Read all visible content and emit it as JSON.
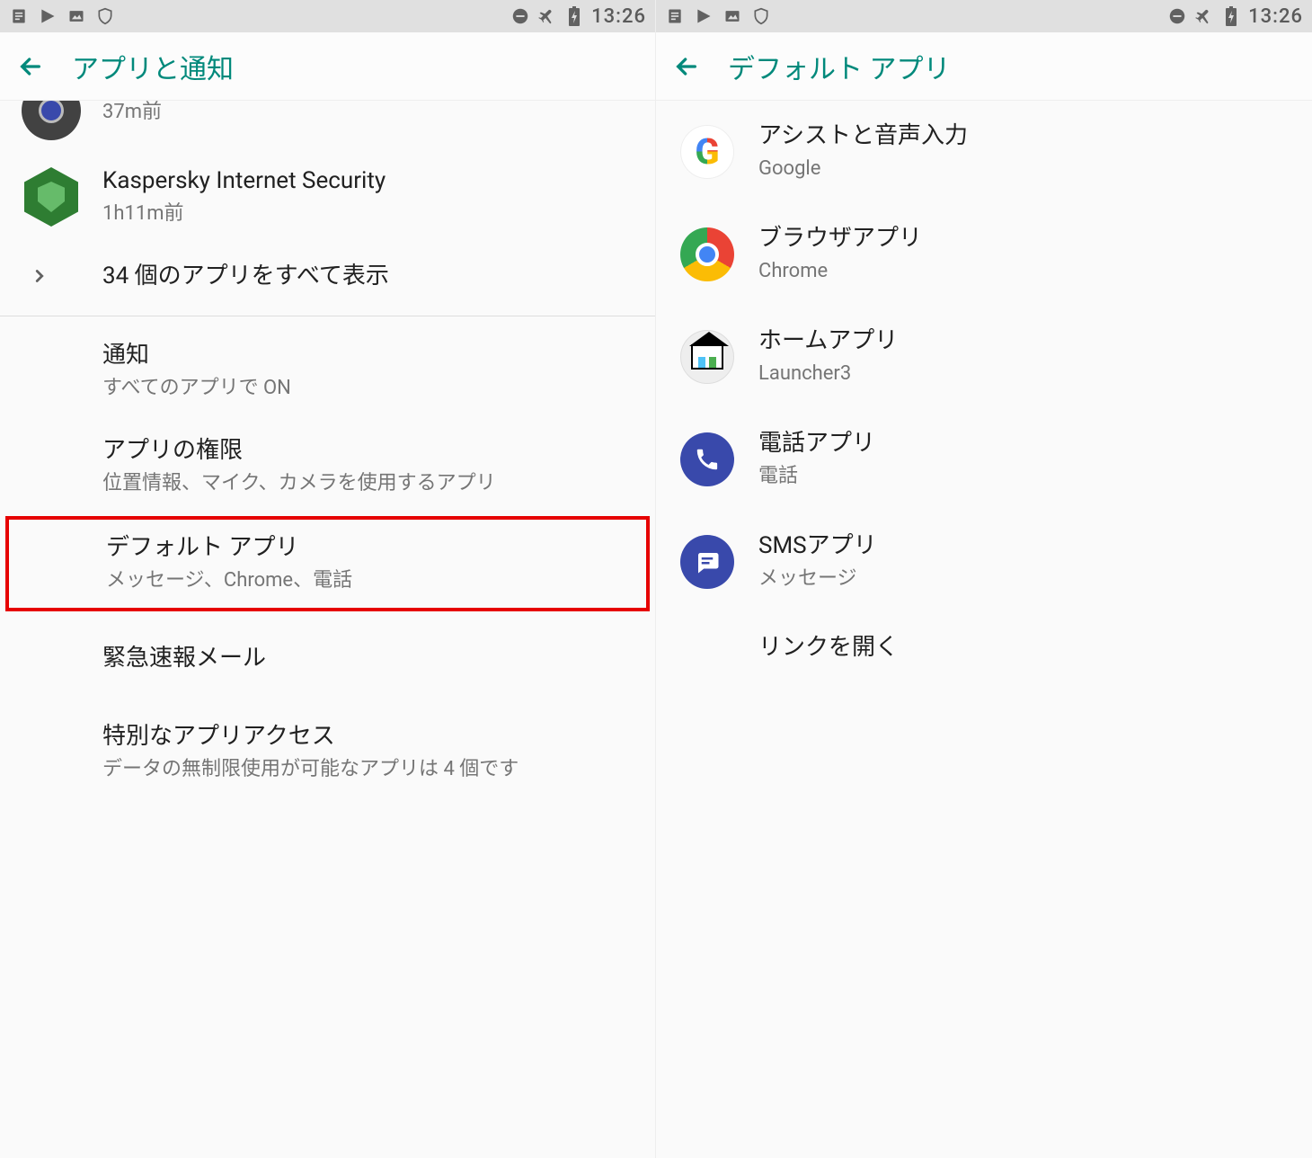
{
  "status": {
    "time": "13:26"
  },
  "screens": [
    {
      "title": "アプリと通知",
      "camera": {
        "subtitle": "37m前"
      },
      "kaspersky": {
        "title": "Kaspersky Internet Security",
        "subtitle": "1h11m前"
      },
      "see_all": {
        "title": "34 個のアプリをすべて表示"
      },
      "items": [
        {
          "title": "通知",
          "subtitle": "すべてのアプリで ON"
        },
        {
          "title": "アプリの権限",
          "subtitle": "位置情報、マイク、カメラを使用するアプリ"
        },
        {
          "title": "デフォルト アプリ",
          "subtitle": "メッセージ、Chrome、電話",
          "highlight": true
        },
        {
          "title": "緊急速報メール",
          "subtitle": ""
        },
        {
          "title": "特別なアプリアクセス",
          "subtitle": "データの無制限使用が可能なアプリは 4 個です"
        }
      ]
    },
    {
      "title": "デフォルト アプリ",
      "defaults": [
        {
          "title": "アシストと音声入力",
          "subtitle": "Google"
        },
        {
          "title": "ブラウザアプリ",
          "subtitle": "Chrome"
        },
        {
          "title": "ホームアプリ",
          "subtitle": "Launcher3"
        },
        {
          "title": "電話アプリ",
          "subtitle": "電話"
        },
        {
          "title": "SMSアプリ",
          "subtitle": "メッセージ"
        }
      ],
      "open_links": "リンクを開く"
    }
  ]
}
